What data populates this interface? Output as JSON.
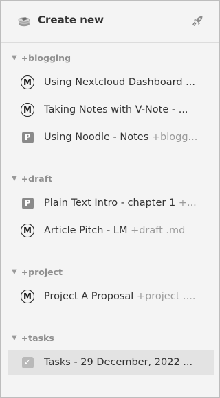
{
  "header": {
    "title": "Create new",
    "logo_icon": "notebook-logo-icon",
    "rocket_icon": "rocket-icon"
  },
  "groups": [
    {
      "name": "+blogging",
      "items": [
        {
          "icon": "markdown-circle-m-icon",
          "title": "Using Nextcloud Dashboard ...",
          "tag": ""
        },
        {
          "icon": "markdown-circle-m-icon",
          "title": "Taking Notes with V-Note - ...",
          "tag": ""
        },
        {
          "icon": "plaintext-p-icon",
          "title": "Using Noodle - Notes ",
          "tag": "+blogg..."
        }
      ]
    },
    {
      "name": "+draft",
      "items": [
        {
          "icon": "plaintext-p-icon",
          "title": "Plain Text Intro - chapter 1 ",
          "tag": "+..."
        },
        {
          "icon": "markdown-circle-m-icon",
          "title": "Article Pitch - LM ",
          "tag": "+draft .md"
        }
      ]
    },
    {
      "name": "+project",
      "items": [
        {
          "icon": "markdown-circle-m-icon",
          "title": "Project A Proposal ",
          "tag": "+project ...."
        }
      ]
    },
    {
      "name": "+tasks",
      "items": [
        {
          "icon": "checkbox-checked-icon",
          "title": "Tasks - 29 December, 2022 ...",
          "tag": "",
          "selected": true
        }
      ]
    }
  ],
  "glyphs": {
    "collapse": "▼",
    "m": "M",
    "p": "P",
    "check": "✓"
  },
  "colors": {
    "background": "#f4f4f4",
    "text": "#333333",
    "muted": "#8f8f8f",
    "selected": "#e3e3e3"
  }
}
